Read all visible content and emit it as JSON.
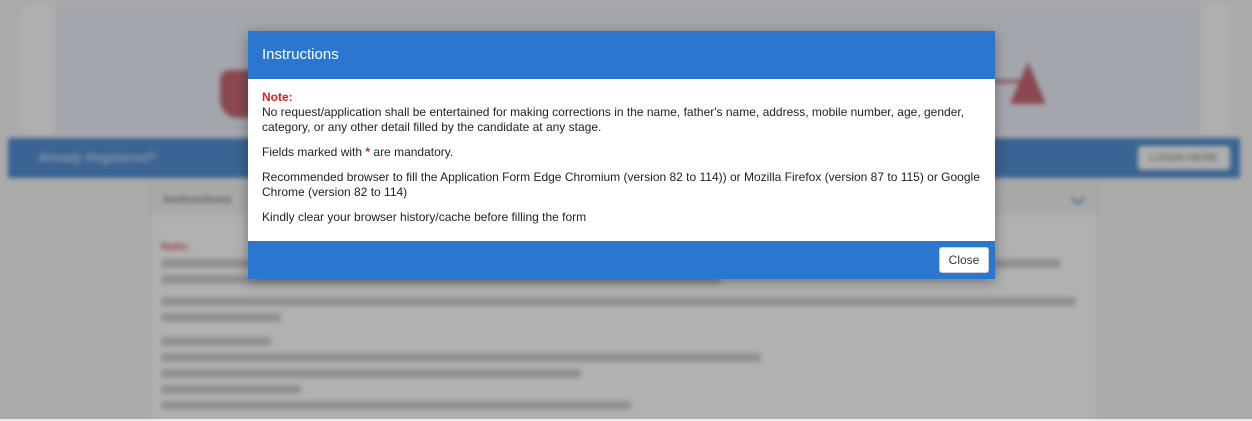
{
  "background": {
    "bar_text": "Already Registered?",
    "login_button": "LOGIN HERE",
    "panel_title": "Instructions",
    "panel_note": "Note:"
  },
  "modal": {
    "title": "Instructions",
    "note_label": "Note:",
    "note_text": "No request/application shall be entertained for making corrections in the name, father's name, address, mobile number, age, gender, category, or any other detail filled by the candidate at any stage.",
    "mandatory_prefix": "Fields marked with",
    "mandatory_asterisk": "*",
    "mandatory_suffix": "are mandatory.",
    "browser_text": "Recommended browser to fill the Application Form Edge Chromium (version 82 to 114)) or Mozilla Firefox (version 87 to 115) or Google Chrome (version 82 to 114)",
    "cache_text": "Kindly clear your browser history/cache before filling the form",
    "close_label": "Close"
  },
  "colors": {
    "modal_blue": "#2b77cf",
    "required_red": "#e01f1f"
  }
}
